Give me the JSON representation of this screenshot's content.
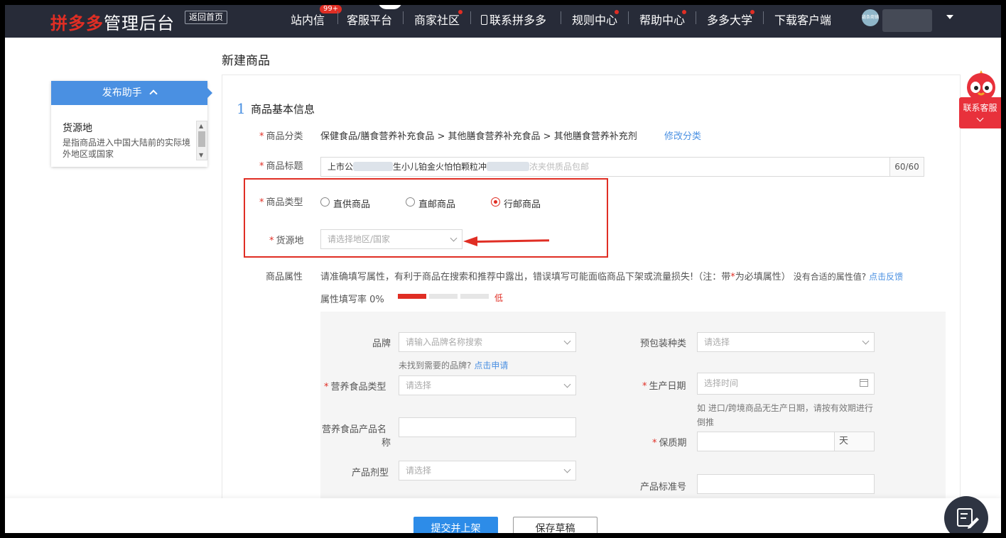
{
  "header": {
    "logo_brand": "拼多多",
    "logo_suffix": "管理后台",
    "back_home": "返回首页",
    "nav": [
      "站内信",
      "客服平台",
      "商家社区",
      "联系拼多多",
      "规则中心",
      "帮助中心",
      "多多大学",
      "下载客户端"
    ],
    "inbox_badge": "99+",
    "avatar_text": "链条商铺"
  },
  "page": {
    "title": "新建商品"
  },
  "sidebar": {
    "header": "发布助手",
    "item_title": "货源地",
    "item_desc": "是指商品进入中国大陆前的实际境外地区或国家"
  },
  "section": {
    "number": "1",
    "title": "商品基本信息"
  },
  "form": {
    "category_label": "商品分类",
    "category_value": "保健食品/膳食营养补充食品 > 其他膳食营养补充食品 > 其他膳食营养补充剂",
    "category_edit": "修改分类",
    "title_label": "商品标题",
    "title_seg1": "上市公",
    "title_seg2": "生小儿铂金火怕怕颗粒冲",
    "title_seg3": "浓夹供质品包邮",
    "title_counter": "60/60",
    "type_label": "商品类型",
    "type_options": [
      "直供商品",
      "直邮商品",
      "行邮商品"
    ],
    "type_selected": 2,
    "origin_label": "货源地",
    "origin_placeholder": "请选择地区/国家",
    "attr_label": "商品属性",
    "attr_note": "请准确填写属性，有利于商品在搜索和推荐中露出，错误填写可能面临商品下架或流量损失!（注：带",
    "attr_note_star": "*",
    "attr_note_tail": "为必填属性）",
    "attr_no_fit": "没有合适的属性值?",
    "attr_feedback": "点击反馈",
    "fill_rate_label": "属性填写率 0%",
    "fill_rate_level": "低",
    "fill_rate_segments_filled": 1,
    "fill_rate_segments_total": 3
  },
  "attributes": {
    "brand_label": "品牌",
    "brand_placeholder": "请输入品牌名称搜索",
    "brand_hint": "未找到需要的品牌?",
    "brand_apply": "点击申请",
    "package_label": "预包装种类",
    "package_placeholder": "请选择",
    "nutrition_type_label": "营养食品类型",
    "nutrition_type_placeholder": "请选择",
    "production_date_label": "生产日期",
    "production_date_placeholder": "选择时间",
    "production_date_hint_1": "如 进口/跨境商品无生产日期，请按有效期进行",
    "production_date_hint_2": "倒推",
    "product_name_label_1": "营养食品产品名",
    "product_name_label_2": "称",
    "shelf_life_label": "保质期",
    "shelf_life_unit": "天",
    "dosage_label": "产品剂型",
    "dosage_placeholder": "请选择",
    "standard_label": "产品标准号"
  },
  "footer": {
    "submit": "提交并上架",
    "save_draft": "保存草稿"
  },
  "widget": {
    "contact": "联系客服"
  },
  "colors": {
    "brand_red": "#e02e24",
    "header_bg": "#272b38",
    "link_blue": "#4a90e2",
    "primary_blue": "#2d8ce8"
  }
}
